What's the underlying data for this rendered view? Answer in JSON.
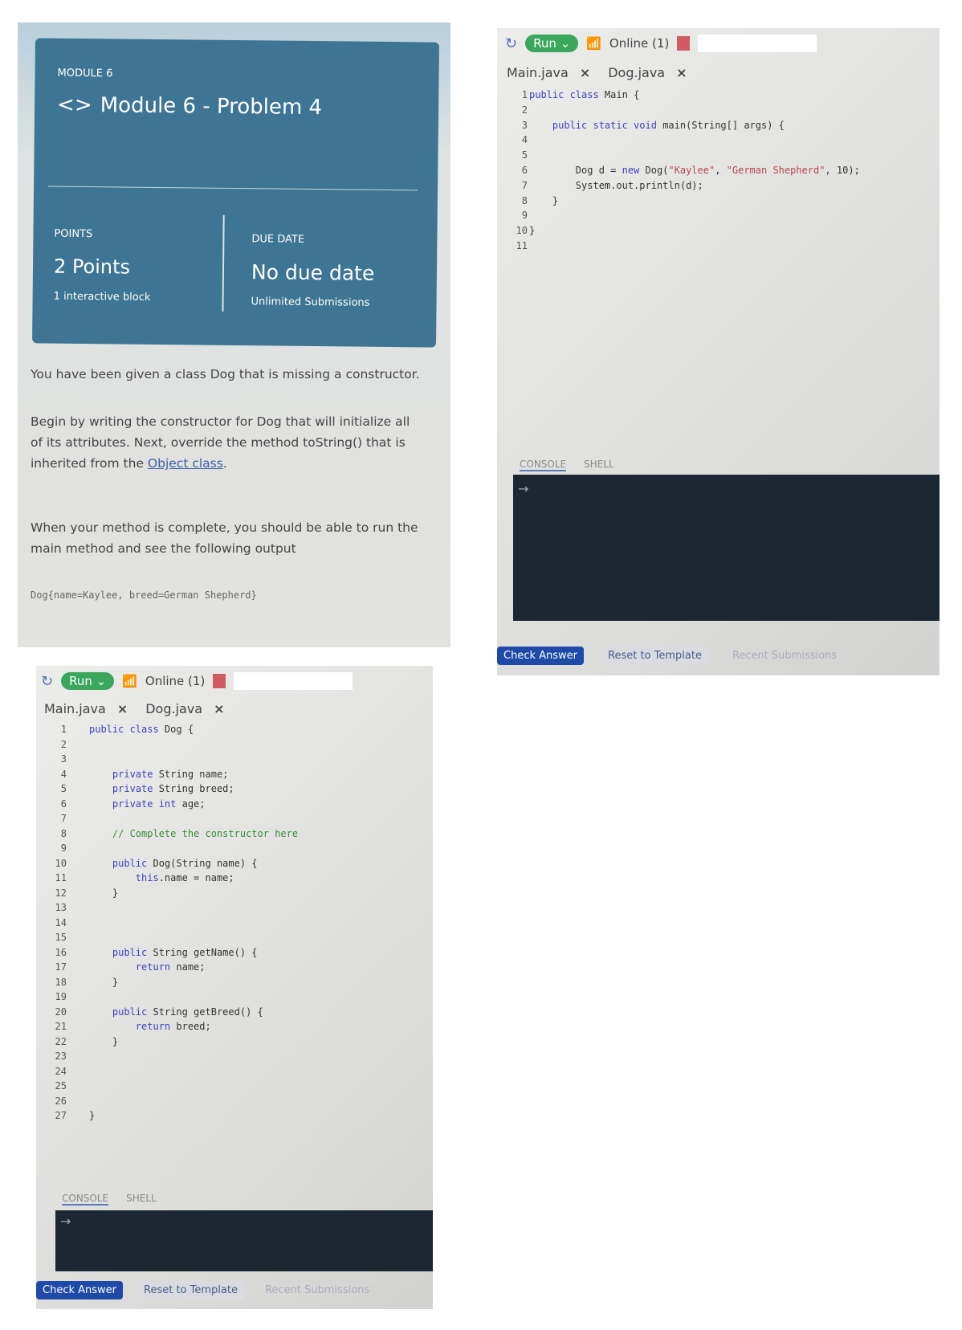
{
  "assignment": {
    "module_label": "MODULE 6",
    "title_icon": "code-brackets-icon",
    "title": "Module 6 - Problem 4",
    "points_label": "POINTS",
    "points_value": "2 Points",
    "points_sub": "1 interactive block",
    "due_label": "DUE DATE",
    "due_value": "No due date",
    "due_sub": "Unlimited Submissions",
    "p1": "You have been given a class Dog that is missing a constructor.",
    "p2_before": "Begin by writing the constructor for Dog that will initialize all of its attributes. Next, override the method toString() that is inherited from the ",
    "p2_link": "Object class",
    "p2_after": ".",
    "p3": "When your method is complete, you should be able to run the main method and see the following output",
    "output": "Dog{name=Kaylee, breed=German Shepherd}"
  },
  "toolbar": {
    "run_label": "Run",
    "status": "Online (1)",
    "status_color": "#d25b63",
    "run_color": "#3aa75c"
  },
  "tabs": [
    "Main.java",
    "Dog.java"
  ],
  "close_glyph": "×",
  "console_tabs": [
    "CONSOLE",
    "SHELL"
  ],
  "console_prompt": "→",
  "buttons": {
    "check": "Check Answer",
    "reset": "Reset to Template",
    "recent": "Recent Submissions"
  },
  "main_code": [
    [
      [
        "kw",
        "public class "
      ],
      [
        "",
        "Main {"
      ]
    ],
    [],
    [
      [
        "",
        "    "
      ],
      [
        "kw",
        "public static void "
      ],
      [
        "",
        "main(String[] args) {"
      ]
    ],
    [],
    [],
    [
      [
        "",
        "        Dog d = "
      ],
      [
        "kw",
        "new "
      ],
      [
        "",
        "Dog("
      ],
      [
        "str",
        "\"Kaylee\""
      ],
      [
        "",
        ", "
      ],
      [
        "str",
        "\"German Shepherd\""
      ],
      [
        "",
        ", 10);"
      ]
    ],
    [
      [
        "",
        "        System.out.println(d);"
      ]
    ],
    [
      [
        "",
        "    }"
      ]
    ],
    [],
    [
      [
        "",
        "}"
      ]
    ],
    []
  ],
  "dog_code": [
    [
      [
        "kw",
        "public class "
      ],
      [
        "",
        "Dog {"
      ]
    ],
    [],
    [],
    [
      [
        "",
        "    "
      ],
      [
        "kw",
        "private "
      ],
      [
        "",
        "String name;"
      ]
    ],
    [
      [
        "",
        "    "
      ],
      [
        "kw",
        "private "
      ],
      [
        "",
        "String breed;"
      ]
    ],
    [
      [
        "",
        "    "
      ],
      [
        "kw",
        "private int "
      ],
      [
        "",
        "age;"
      ]
    ],
    [],
    [
      [
        "cm",
        "    // Complete the constructor here"
      ]
    ],
    [],
    [
      [
        "",
        "    "
      ],
      [
        "kw",
        "public "
      ],
      [
        "",
        "Dog(String name) {"
      ]
    ],
    [
      [
        "",
        "        "
      ],
      [
        "kw",
        "this"
      ],
      [
        "",
        ".name = name;"
      ]
    ],
    [
      [
        "",
        "    }"
      ]
    ],
    [],
    [],
    [],
    [
      [
        "",
        "    "
      ],
      [
        "kw",
        "public "
      ],
      [
        "",
        "String getName() {"
      ]
    ],
    [
      [
        "",
        "        "
      ],
      [
        "kw",
        "return "
      ],
      [
        "",
        "name;"
      ]
    ],
    [
      [
        "",
        "    }"
      ]
    ],
    [],
    [
      [
        "",
        "    "
      ],
      [
        "kw",
        "public "
      ],
      [
        "",
        "String getBreed() {"
      ]
    ],
    [
      [
        "",
        "        "
      ],
      [
        "kw",
        "return "
      ],
      [
        "",
        "breed;"
      ]
    ],
    [
      [
        "",
        "    }"
      ]
    ],
    [],
    [],
    [],
    [],
    [
      [
        "",
        "}"
      ]
    ]
  ]
}
